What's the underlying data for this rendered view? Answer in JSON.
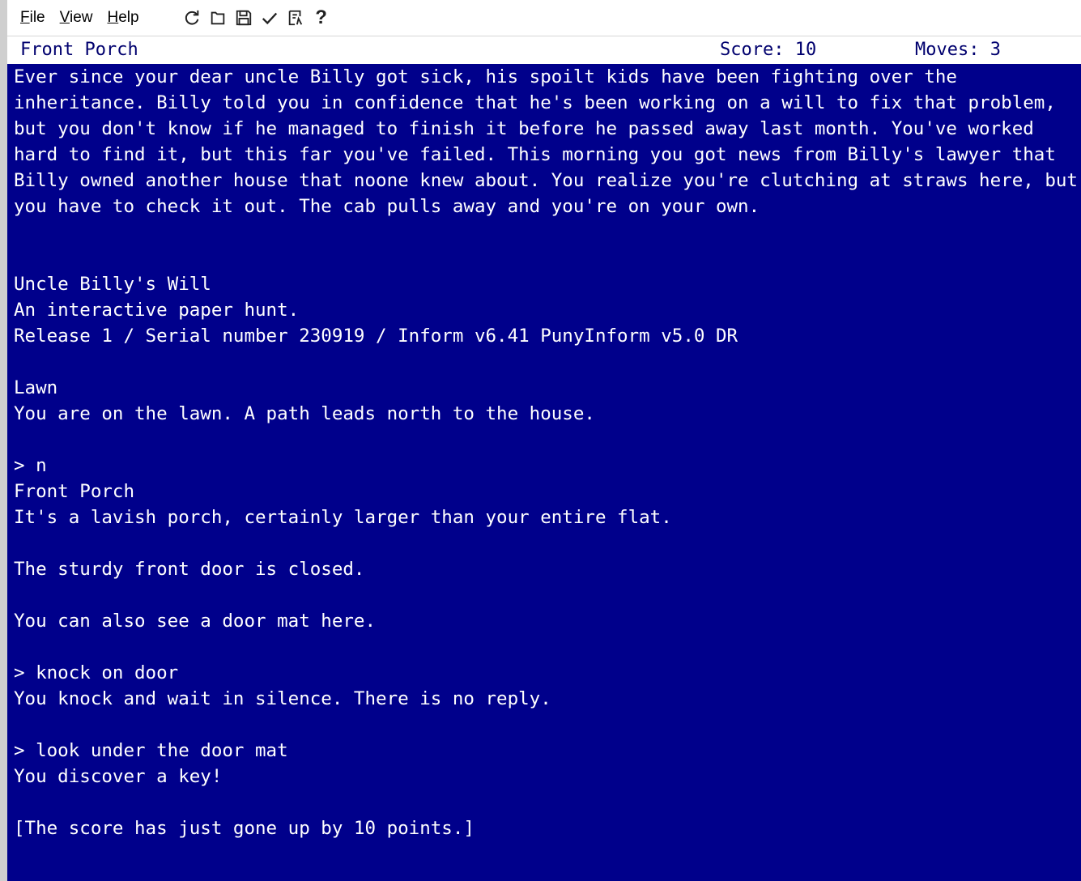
{
  "menu": {
    "file": {
      "underline": "F",
      "rest": "ile"
    },
    "view": {
      "underline": "V",
      "rest": "iew"
    },
    "help": {
      "underline": "H",
      "rest": "elp"
    }
  },
  "toolbar": {
    "icons": [
      "restart-icon",
      "new-icon",
      "save-icon",
      "check-icon",
      "transcript-icon",
      "help-icon"
    ],
    "help_glyph": "?"
  },
  "status": {
    "location": "Front Porch",
    "score": "Score: 10",
    "moves": "Moves: 3"
  },
  "colors": {
    "background": "#00008b",
    "text": "#ffffff",
    "status_text": "#00006e"
  },
  "story": {
    "intro": "Ever since your dear uncle Billy got sick, his spoilt kids have been fighting over the inheritance. Billy told you in confidence that he's been working on a will to fix that problem, but you don't know if he managed to finish it before he passed away last month. You've worked hard to find it, but this far you've failed. This morning you got news from Billy's lawyer that Billy owned another house that noone knew about. You realize you're clutching at straws here, but you have to check it out. The cab pulls away and you're on your own.",
    "title": "Uncle Billy's Will",
    "subtitle": "An interactive paper hunt.",
    "release": "Release 1 / Serial number 230919 / Inform v6.41 PunyInform v5.0 DR",
    "room1_name": "Lawn",
    "room1_desc": "You are on the lawn. A path leads north to the house.",
    "cmd1": "> n",
    "room2_name": "Front Porch",
    "room2_desc": "It's a lavish porch, certainly larger than your entire flat.",
    "door_desc": "The sturdy front door is closed.",
    "mat_desc": "You can also see a door mat here.",
    "cmd2": "> knock on door",
    "knock_reply": "You knock and wait in silence. There is no reply.",
    "cmd3": "> look under the door mat",
    "mat_reply": "You discover a key!",
    "score_msg": "[The score has just gone up by 10 points.]"
  }
}
